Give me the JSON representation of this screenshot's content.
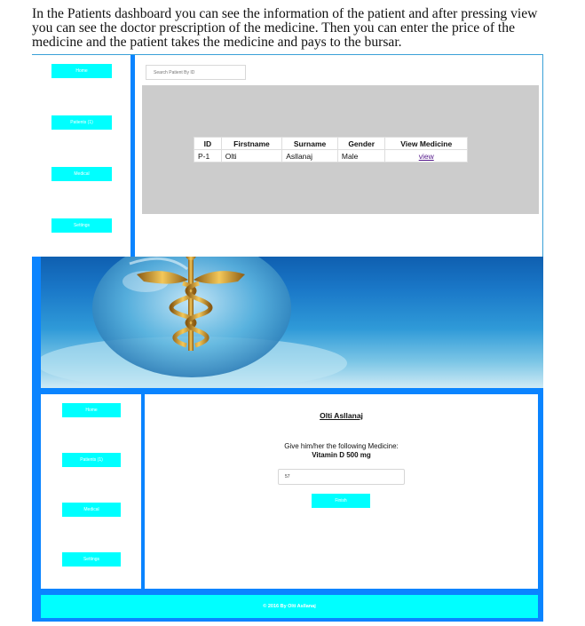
{
  "intro_text": "In the Patients dashboard you can see the information of the patient and after pressing view you can see the doctor prescription of the medicine. Then you can enter the price of the medicine and the patient takes the medicine and pays to the bursar.",
  "colors": {
    "accent_blue": "#0a84ff",
    "nav_cyan": "#00ffff",
    "panel_gray": "#cccccc"
  },
  "dashboard": {
    "nav": [
      {
        "label": "Home"
      },
      {
        "label": "Patients (1)"
      },
      {
        "label": "Medical"
      },
      {
        "label": "Settings"
      }
    ],
    "search_placeholder": "Search Patient By ID",
    "table": {
      "headers": [
        "ID",
        "Firstname",
        "Surname",
        "Gender",
        "View Medicine"
      ],
      "rows": [
        {
          "id": "P-1",
          "firstname": "Olti",
          "surname": "Asllanaj",
          "gender": "Male",
          "view": "view"
        }
      ]
    }
  },
  "medicine_page": {
    "nav": [
      {
        "label": "Home"
      },
      {
        "label": "Patients (1)"
      },
      {
        "label": "Medical"
      },
      {
        "label": "Settings"
      }
    ],
    "patient_name": "Olti Asllanaj",
    "instruction": "Give him/her the following Medicine:",
    "medicine": "Vitamin D 500 mg",
    "price_value": "57",
    "finish_label": "Finish",
    "footer": "© 2016 By Olti Asllanaj"
  }
}
